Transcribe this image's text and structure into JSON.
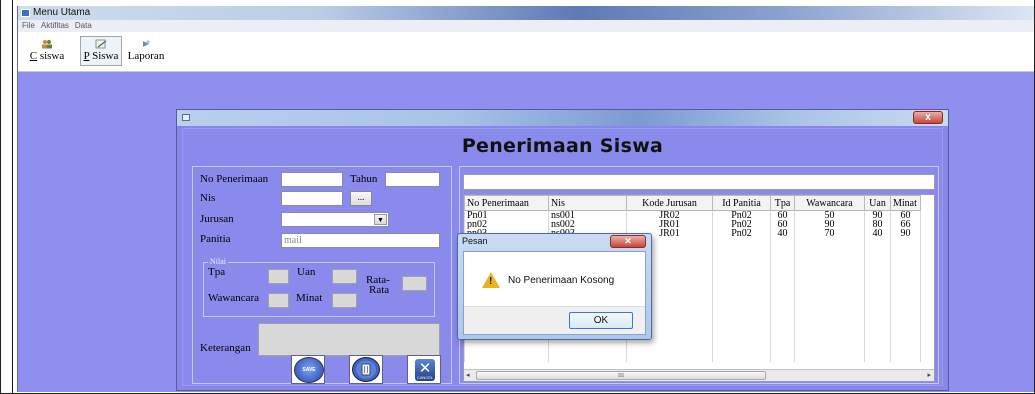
{
  "window": {
    "title": "Menu Utama"
  },
  "menu": {
    "items": [
      "File",
      "Aktifitas",
      "Data"
    ]
  },
  "toolbar": {
    "buttons": [
      {
        "mnemonic": "C",
        "rest": " siswa",
        "icon": "people-icon"
      },
      {
        "mnemonic": "P",
        "rest": " Siswa",
        "icon": "edit-icon"
      },
      {
        "mnemonic": "",
        "rest": "Laporan",
        "icon": "report-icon"
      }
    ]
  },
  "dialog": {
    "heading": "Penerimaan Siswa",
    "close": "x"
  },
  "form": {
    "no_penerimaan_label": "No Penerimaan",
    "tahun_label": "Tahun",
    "nis_label": "Nis",
    "nis_browse": "...",
    "jurusan_label": "Jurusan",
    "panitia_label": "Panitia",
    "panitia_value": "mail",
    "nilai_legend": "Nilai",
    "tpa_label": "Tpa",
    "uan_label": "Uan",
    "rata_label_1": "Rata-",
    "rata_label_2": "Rata",
    "wawancara_label": "Wawancara",
    "minat_label": "Minat",
    "keterangan_label": "Keterangan"
  },
  "buttons": {
    "save": "SAVE",
    "cancel": "CANCEL"
  },
  "table": {
    "columns": [
      "No Penerimaan",
      "Nis",
      "Kode Jurusan",
      "Id Panitia",
      "Tpa",
      "Wawancara",
      "Uan",
      "Minat"
    ],
    "rows": [
      [
        "Pn01",
        "ns001",
        "JR02",
        "Pn02",
        "60",
        "50",
        "90",
        "60"
      ],
      [
        "pn02",
        "ns002",
        "JR01",
        "Pn02",
        "60",
        "90",
        "80",
        "66"
      ],
      [
        "pn03",
        "ns003",
        "JR01",
        "Pn02",
        "40",
        "70",
        "40",
        "90"
      ]
    ],
    "scroll_label": "III"
  },
  "message_box": {
    "title": "Pesan",
    "text": "No Penerimaan Kosong",
    "ok": "OK"
  },
  "colors": {
    "background": "#8f8ff0",
    "dialog": "#8787ea",
    "warning": "#e9b51c"
  }
}
